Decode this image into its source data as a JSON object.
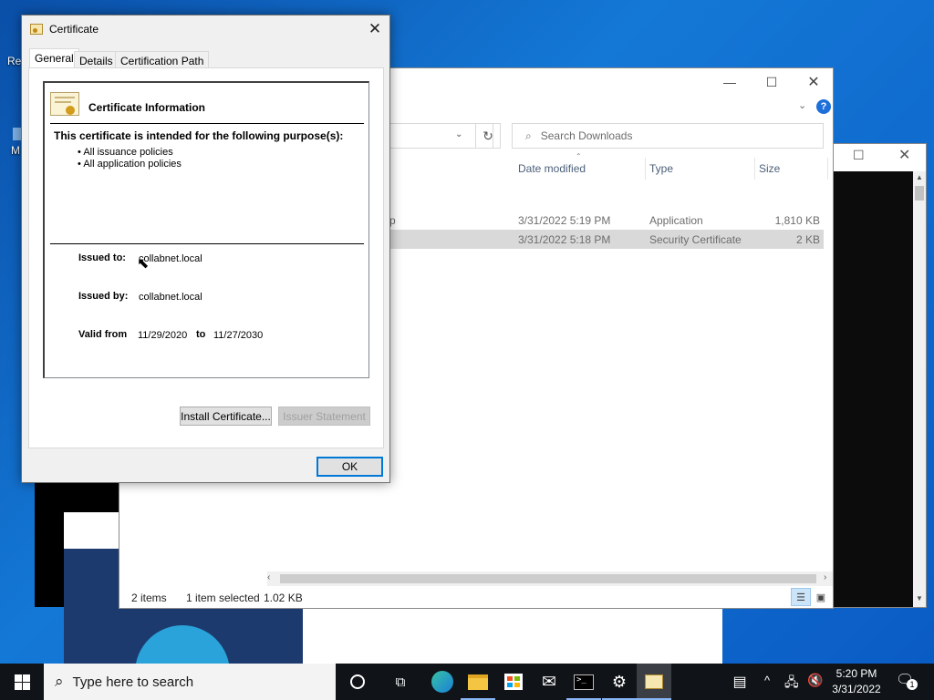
{
  "desktop": {
    "icon_label_1": "Re",
    "icon_label_2": "M"
  },
  "explorer": {
    "search_placeholder": "Search Downloads",
    "columns": {
      "date_modified": "Date modified",
      "type": "Type",
      "size": "Size"
    },
    "rows": [
      {
        "name_fragment": "p",
        "date": "3/31/2022 5:19 PM",
        "type": "Application",
        "size": "1,810 KB"
      },
      {
        "name_fragment": "",
        "date": "3/31/2022 5:18 PM",
        "type": "Security Certificate",
        "size": "2 KB"
      }
    ],
    "status": {
      "items": "2 items",
      "selected": "1 item selected",
      "selected_size": "1.02 KB"
    }
  },
  "dialog": {
    "title": "Certificate",
    "tabs": [
      "General",
      "Details",
      "Certification Path"
    ],
    "info_heading": "Certificate Information",
    "purpose_heading": "This certificate is intended for the following purpose(s):",
    "purposes": [
      "All issuance policies",
      "All application policies"
    ],
    "issued_to_label": "Issued to:",
    "issued_to_value": "collabnet.local",
    "issued_by_label": "Issued by:",
    "issued_by_value": "collabnet.local",
    "valid_from_label": "Valid from",
    "valid_from_value": "11/29/2020",
    "valid_to_label": "to",
    "valid_to_value": "11/27/2030",
    "install_button": "Install Certificate...",
    "issuer_button": "Issuer Statement",
    "ok_button": "OK"
  },
  "taskbar": {
    "search_placeholder": "Type here to search",
    "time": "5:20 PM",
    "date": "3/31/2022",
    "notification_count": "1"
  }
}
